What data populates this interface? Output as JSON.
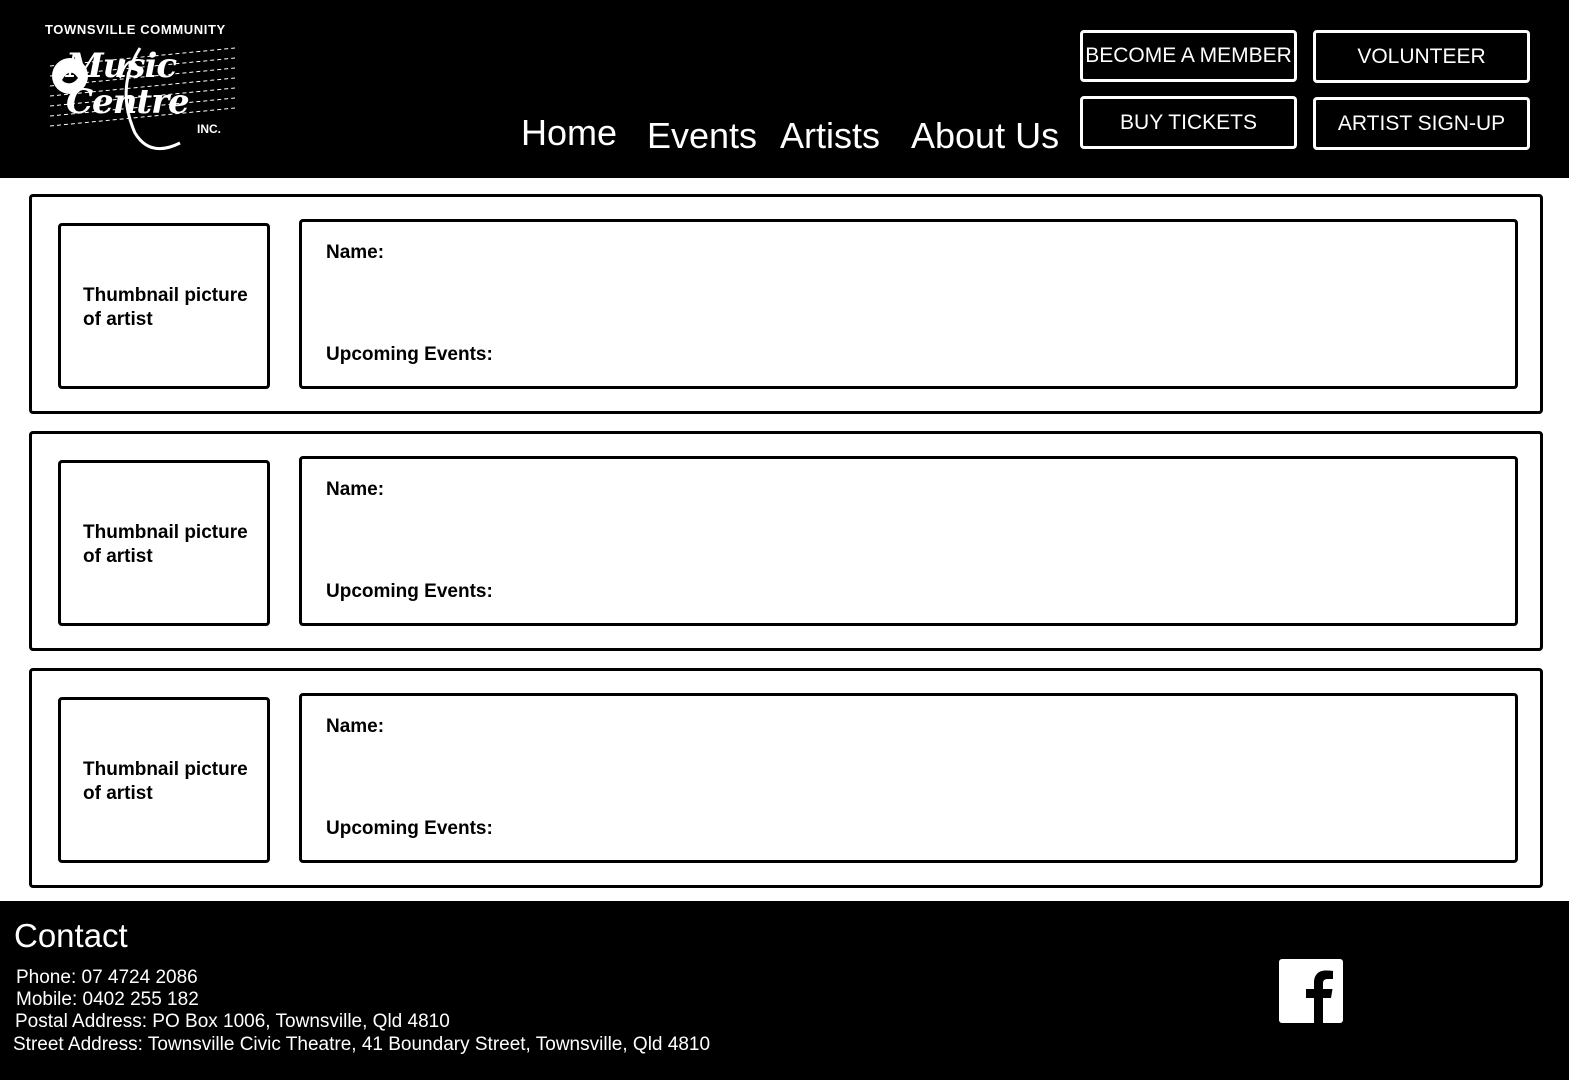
{
  "header": {
    "logo": {
      "top_text": "TOWNSVILLE COMMUNITY",
      "script_text": "Music Centre",
      "inc_text": "INC."
    },
    "nav": [
      {
        "label": "Home"
      },
      {
        "label": "Events"
      },
      {
        "label": "Artists"
      },
      {
        "label": "About Us"
      }
    ],
    "buttons": {
      "become_member": "BECOME A MEMBER",
      "volunteer": "VOLUNTEER",
      "buy_tickets": "BUY TICKETS",
      "artist_signup": "ARTIST SIGN-UP"
    }
  },
  "artists": [
    {
      "thumbnail_label": "Thumbnail picture of artist",
      "name_label": "Name:",
      "events_label": "Upcoming Events:"
    },
    {
      "thumbnail_label": "Thumbnail picture of artist",
      "name_label": "Name:",
      "events_label": "Upcoming Events:"
    },
    {
      "thumbnail_label": "Thumbnail picture of artist",
      "name_label": "Name:",
      "events_label": "Upcoming Events:"
    }
  ],
  "footer": {
    "title": "Contact",
    "phone": "Phone: 07 4724 2086",
    "mobile": "Mobile: 0402 255 182",
    "postal": "Postal Address:  PO Box 1006, Townsville, Qld 4810",
    "street": "Street Address:  Townsville Civic Theatre, 41 Boundary Street, Townsville, Qld 4810",
    "social_icon": "facebook-icon"
  },
  "colors": {
    "background": "#000000",
    "text_on_dark": "#ffffff",
    "border": "#000000"
  }
}
